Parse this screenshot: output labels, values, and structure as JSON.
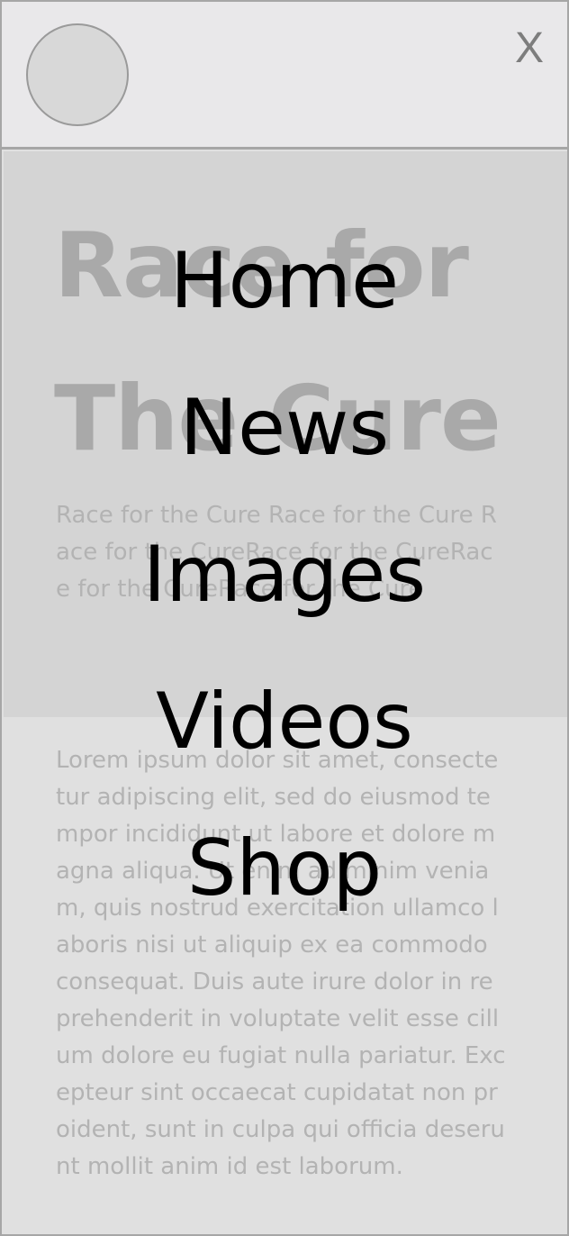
{
  "header": {
    "close_label": "X"
  },
  "hero": {
    "title": "Race for\nThe Cure",
    "text": "Race for the Cure Race for the Cure Race for the CureRace for the CureRace for the CureRace for the Cure"
  },
  "body": {
    "text": "Lorem ipsum dolor sit amet, consectetur adipiscing elit, sed do eiusmod tempor incididunt ut labore et dolore magna aliqua. Ut enim ad minim veniam, quis nostrud exercitation ullamco laboris nisi ut aliquip ex ea commodo consequat. Duis aute irure dolor in reprehenderit in voluptate velit esse cillum dolore eu fugiat nulla pariatur. Excepteur sint occaecat cupidatat non proident, sunt in culpa qui officia deserunt mollit anim id est laborum."
  },
  "nav": {
    "items": [
      {
        "label": "Home"
      },
      {
        "label": "News"
      },
      {
        "label": "Images"
      },
      {
        "label": "Videos"
      },
      {
        "label": "Shop"
      }
    ]
  }
}
